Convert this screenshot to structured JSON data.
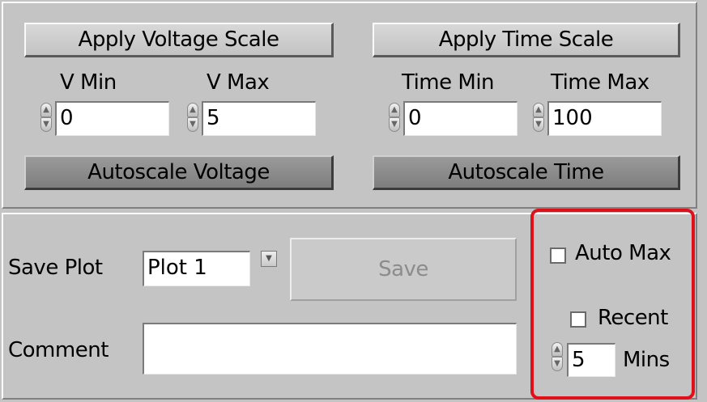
{
  "voltage": {
    "apply_label": "Apply Voltage Scale",
    "vmin_label": "V Min",
    "vmax_label": "V Max",
    "vmin_value": "0",
    "vmax_value": "5",
    "autoscale_label": "Autoscale Voltage"
  },
  "time": {
    "apply_label": "Apply Time Scale",
    "tmin_label": "Time Min",
    "tmax_label": "Time Max",
    "tmin_value": "0",
    "tmax_value": "100",
    "autoscale_label": "Autoscale Time"
  },
  "save": {
    "label": "Save Plot",
    "selected": "Plot 1",
    "button_label": "Save",
    "comment_label": "Comment",
    "comment_value": ""
  },
  "options": {
    "auto_max_label": "Auto Max",
    "recent_label": "Recent",
    "mins_value": "5",
    "mins_label": "Mins"
  },
  "colors": {
    "panel": "#c4c4c4",
    "highlight": "#e0101a"
  },
  "icons": {
    "spinner": "spin-updown-icon",
    "dropdown": "dropdown-arrow-icon"
  }
}
